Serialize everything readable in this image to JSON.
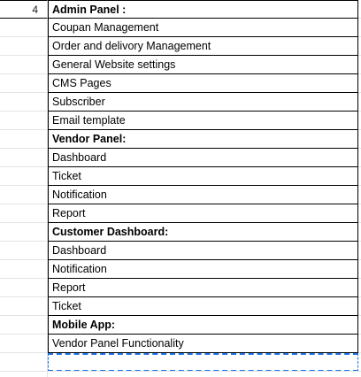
{
  "sheet": {
    "row_number": "4",
    "cells": [
      {
        "text": "Admin Panel :",
        "bold": true
      },
      {
        "text": "Coupan Management",
        "bold": false
      },
      {
        "text": "Order and delivory Management",
        "bold": false
      },
      {
        "text": "General Website settings",
        "bold": false
      },
      {
        "text": "CMS Pages",
        "bold": false
      },
      {
        "text": "Subscriber",
        "bold": false
      },
      {
        "text": "Email template",
        "bold": false
      },
      {
        "text": "Vendor Panel:",
        "bold": true
      },
      {
        "text": "Dashboard",
        "bold": false
      },
      {
        "text": "Ticket",
        "bold": false
      },
      {
        "text": "Notification",
        "bold": false
      },
      {
        "text": "Report",
        "bold": false
      },
      {
        "text": "Customer Dashboard:",
        "bold": true
      },
      {
        "text": "Dashboard",
        "bold": false
      },
      {
        "text": "Notification",
        "bold": false
      },
      {
        "text": "Report",
        "bold": false
      },
      {
        "text": "Ticket",
        "bold": false
      },
      {
        "text": "Mobile App:",
        "bold": true
      },
      {
        "text": "Vendor Panel Functionality",
        "bold": false
      },
      {
        "text": "",
        "bold": false
      }
    ]
  }
}
